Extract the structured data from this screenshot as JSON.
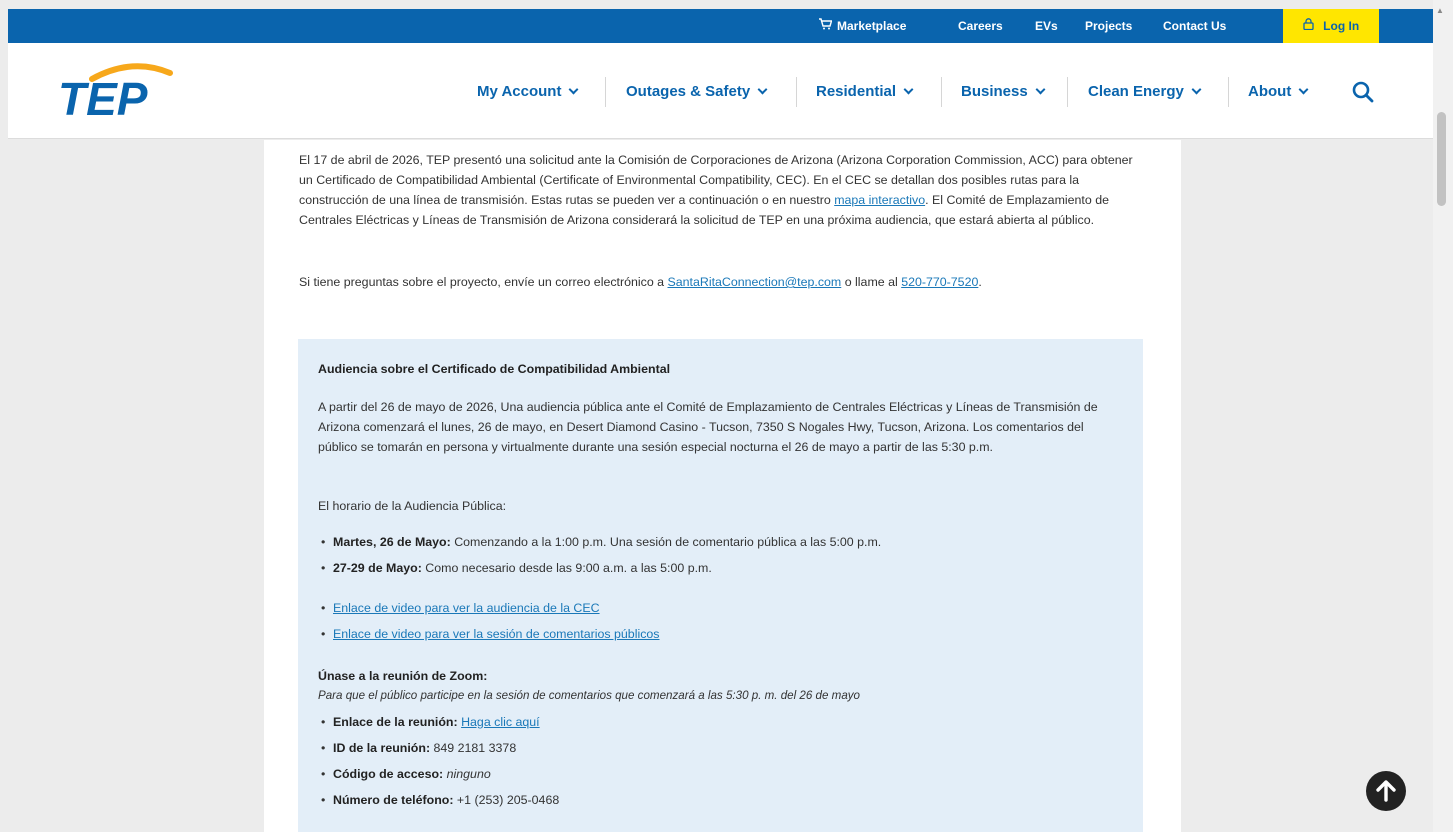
{
  "topbar": {
    "marketplace": "Marketplace",
    "careers": "Careers",
    "evs": "EVs",
    "projects": "Projects",
    "contact": "Contact Us",
    "login": "Log In"
  },
  "logo": {
    "text": "TEP"
  },
  "nav": {
    "my_account": "My Account",
    "outages": "Outages & Safety",
    "residential": "Residential",
    "business": "Business",
    "clean_energy": "Clean Energy",
    "about": "About"
  },
  "intro": {
    "p1_a": "El 17 de abril de 2026, TEP presentó una solicitud ante la Comisión de Corporaciones de Arizona (Arizona Corporation Commission, ACC) para obtener un Certificado de Compatibilidad Ambiental (Certificate of Environmental Compatibility, CEC). En el CEC se detallan dos posibles rutas para la construcción de una línea de transmisión. Estas rutas se pueden ver a continuación o en nuestro ",
    "p1_link": "mapa interactivo",
    "p1_b": ". El Comité de Emplazamiento de Centrales Eléctricas y Líneas de Transmisión de Arizona considerará la solicitud de TEP en una próxima audiencia, que estará abierta al público.",
    "p2_a": "Si tiene preguntas sobre el proyecto, envíe un correo electrónico a ",
    "p2_email": "SantaRitaConnection@tep.com",
    "p2_b": " o llame al ",
    "p2_phone": "520-770-7520",
    "p2_c": "."
  },
  "hearing": {
    "title": "Audiencia sobre el Certificado de Compatibilidad Ambiental",
    "body": "A partir del 26 de mayo de 2026, Una audiencia pública ante el Comité de Emplazamiento de Centrales Eléctricas y Líneas de Transmisión de Arizona comenzará el lunes, 26 de mayo, en Desert Diamond Casino - Tucson, 7350 S Nogales Hwy, Tucson, Arizona. Los comentarios del público se tomarán en persona y virtualmente durante una sesión especial nocturna el 26 de mayo a partir de las 5:30 p.m.",
    "schedule_label": "El horario de la Audiencia Pública:",
    "schedule": [
      {
        "bold": "Martes, 26 de Mayo:",
        "text": " Comenzando a la 1:00 p.m. Una sesión de comentario pública a las 5:00 p.m."
      },
      {
        "bold": "27-29 de Mayo:",
        "text": " Como necesario desde las 9:00 a.m. a las 5:00 p.m."
      }
    ],
    "links": [
      "Enlace de video para ver la audiencia de la CEC",
      "Enlace de video para ver la sesión de comentarios públicos"
    ],
    "zoom_title": "Únase a la reunión de Zoom:",
    "zoom_note": "Para que el público participe en la sesión de comentarios que comenzará a las 5:30 p. m. del 26 de mayo",
    "zoom_link_label": "Enlace de la reunión:",
    "zoom_link_text": "Haga clic aquí",
    "meeting_id_label": "ID de la reunión:",
    "meeting_id": " 849 2181 3378",
    "passcode_label": "Código de acceso:",
    "passcode": "ninguno",
    "phone_label": "Número de teléfono:",
    "phone": " +1 (253) 205-0468"
  },
  "colors": {
    "brand_blue": "#0a64ad",
    "login_yellow": "#ffe600",
    "box_bg": "#e3eef8",
    "link": "#1a78b8"
  }
}
